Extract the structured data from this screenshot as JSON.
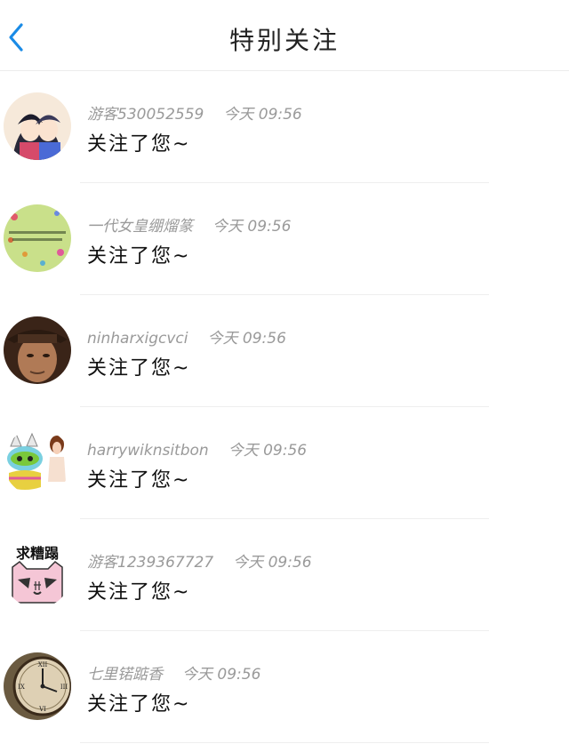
{
  "header": {
    "title": "特别关注",
    "back_icon": "chevron-left-icon",
    "accent_color": "#1a8be6"
  },
  "items": [
    {
      "name": "游客530052559",
      "time": "今天 09:56",
      "message": "关注了您~",
      "avatar": "girl-avatar"
    },
    {
      "name": "一代女皇绷熘篆",
      "time": "今天 09:56",
      "message": "关注了您~",
      "avatar": "floral-avatar"
    },
    {
      "name": "ninharxigcvci",
      "time": "今天 09:56",
      "message": "关注了您~",
      "avatar": "man-hat-avatar"
    },
    {
      "name": "harrywiknsitbon",
      "time": "今天 09:56",
      "message": "关注了您~",
      "avatar": "cartoon-avatar"
    },
    {
      "name": "游客1239367727",
      "time": "今天 09:56",
      "message": "关注了您~",
      "avatar": "cat-avatar"
    },
    {
      "name": "七里锘踮香",
      "time": "今天 09:56",
      "message": "关注了您~",
      "avatar": "clock-avatar"
    }
  ],
  "avatar_text": {
    "cat": "求糟蹋"
  }
}
